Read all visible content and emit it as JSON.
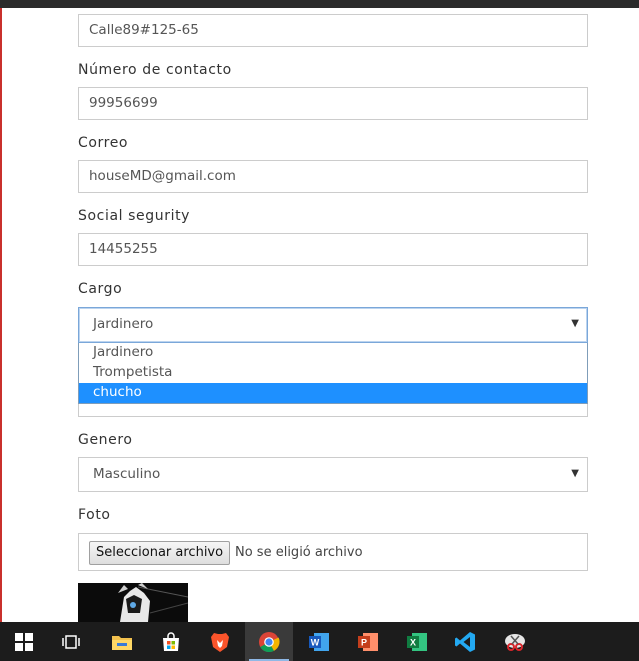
{
  "form": {
    "address_value": "Calle89#125-65",
    "contact_label": "Número de contacto",
    "contact_value": "99956699",
    "email_label": "Correo",
    "email_value": "houseMD@gmail.com",
    "social_label": "Social segurity",
    "social_value": "14455255",
    "cargo_label": "Cargo",
    "cargo_selected": "Jardinero",
    "cargo_options": [
      "Jardinero",
      "Trompetista",
      "chucho"
    ],
    "cargo_highlighted": "chucho",
    "genero_label": "Genero",
    "genero_selected": "Masculino",
    "foto_label": "Foto",
    "file_button": "Seleccionar archivo",
    "file_status": "No se eligió archivo"
  },
  "taskbar": {
    "apps": [
      "windows-start",
      "task-view",
      "file-explorer",
      "microsoft-store",
      "brave",
      "chrome",
      "word",
      "powerpoint",
      "excel",
      "visual-studio-code",
      "snipping-tool"
    ],
    "active_app": "chrome"
  },
  "colors": {
    "highlight": "#1e90ff",
    "frame_border": "#c9302c",
    "taskbar": "#1c1c1c"
  }
}
